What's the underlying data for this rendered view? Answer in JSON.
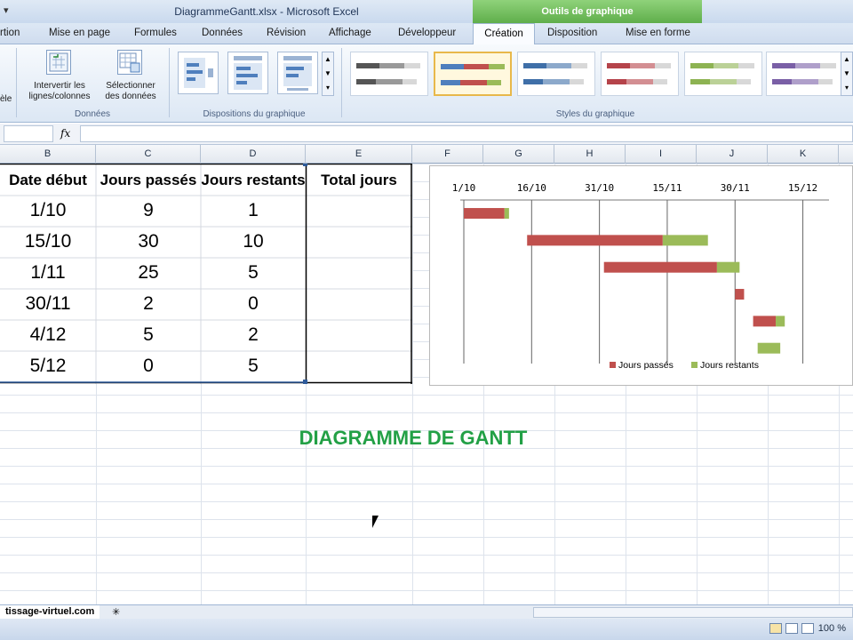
{
  "window": {
    "title": "DiagrammeGantt.xlsx - Microsoft Excel",
    "tools_header": "Outils de graphique"
  },
  "tabs": [
    {
      "label": "rtion"
    },
    {
      "label": "Mise en page"
    },
    {
      "label": "Formules"
    },
    {
      "label": "Données"
    },
    {
      "label": "Révision"
    },
    {
      "label": "Affichage"
    },
    {
      "label": "Développeur"
    },
    {
      "label": "Création"
    },
    {
      "label": "Disposition"
    },
    {
      "label": "Mise en forme"
    }
  ],
  "ribbon": {
    "partial_label": "èle",
    "switch_label": "Intervertir les lignes/colonnes",
    "select_label": "Sélectionner des données",
    "group_data": "Données",
    "group_layouts": "Dispositions du graphique",
    "group_styles": "Styles du graphique",
    "style_colors": [
      "#555555",
      "#4f7fbd",
      "#3f6fa8",
      "#b5434a",
      "#8db352",
      "#7a5fa6"
    ]
  },
  "formula_bar": {
    "fx": "fx",
    "value": ""
  },
  "columns": [
    "B",
    "C",
    "D",
    "E",
    "F",
    "G",
    "H",
    "I",
    "J",
    "K"
  ],
  "table": {
    "headers": [
      "Date début",
      "Jours passés",
      "Jours restants",
      "Total jours"
    ],
    "rows": [
      [
        "1/10",
        "9",
        "1",
        ""
      ],
      [
        "15/10",
        "30",
        "10",
        ""
      ],
      [
        "1/11",
        "25",
        "5",
        ""
      ],
      [
        "30/11",
        "2",
        "0",
        ""
      ],
      [
        "4/12",
        "5",
        "2",
        ""
      ],
      [
        "5/12",
        "0",
        "5",
        ""
      ]
    ]
  },
  "chart_data": {
    "type": "bar",
    "orientation": "horizontal-stacked",
    "x_tick_labels": [
      "1/10",
      "16/10",
      "31/10",
      "15/11",
      "30/11",
      "15/12"
    ],
    "categories": [
      "1/10",
      "15/10",
      "1/11",
      "30/11",
      "4/12",
      "5/12"
    ],
    "series": [
      {
        "name": "Jours passés",
        "color": "#c0504d",
        "values": [
          9,
          30,
          25,
          2,
          5,
          0
        ]
      },
      {
        "name": "Jours restants",
        "color": "#9bbb59",
        "values": [
          1,
          10,
          5,
          0,
          2,
          5
        ]
      }
    ],
    "start_offsets_days": [
      0,
      14,
      31,
      60,
      64,
      65
    ],
    "x_range_days": [
      0,
      80
    ],
    "grid": "vertical",
    "legend": "bottom-right",
    "title": ""
  },
  "sheet": {
    "big_title": "DIAGRAMME DE GANTT",
    "tab_name": "tissage-virtuel.com",
    "zoom": "100 %"
  }
}
